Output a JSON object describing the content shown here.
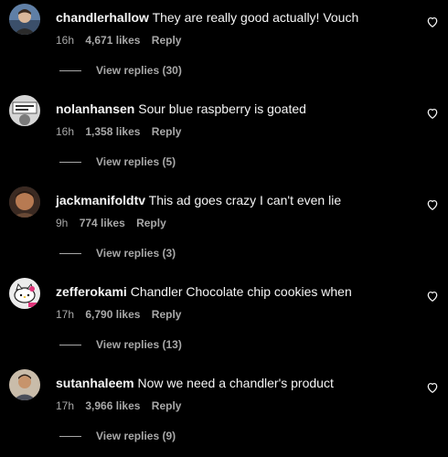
{
  "comments": [
    {
      "username": "chandlerhallow",
      "text": "They are really good actually! Vouch",
      "time": "16h",
      "likes": "4,671 likes",
      "reply": "Reply",
      "view_replies": "View replies (30)",
      "avatar_color": "#6b8bb0",
      "avatar_icon": "profile-photo"
    },
    {
      "username": "nolanhansen",
      "text": "Sour blue raspberry is goated",
      "time": "16h",
      "likes": "1,358 likes",
      "reply": "Reply",
      "view_replies": "View replies (5)",
      "avatar_color": "#cfcfcf",
      "avatar_icon": "profile-photo"
    },
    {
      "username": "jackmanifoldtv",
      "text": "This ad goes crazy I can't even lie",
      "time": "9h",
      "likes": "774 likes",
      "reply": "Reply",
      "view_replies": "View replies (3)",
      "avatar_color": "#8a5a3c",
      "avatar_icon": "profile-photo"
    },
    {
      "username": "zefferokami",
      "text": "Chandler Chocolate chip cookies when",
      "time": "17h",
      "likes": "6,790 likes",
      "reply": "Reply",
      "view_replies": "View replies (13)",
      "avatar_color": "#f0f0f0",
      "avatar_icon": "hello-kitty-avatar"
    },
    {
      "username": "sutanhaleem",
      "text": "Now we need a chandler's product",
      "time": "17h",
      "likes": "3,966 likes",
      "reply": "Reply",
      "view_replies": "View replies (9)",
      "avatar_color": "#b8aa98",
      "avatar_icon": "profile-photo"
    }
  ],
  "heart_icon": "heart-outline-icon"
}
